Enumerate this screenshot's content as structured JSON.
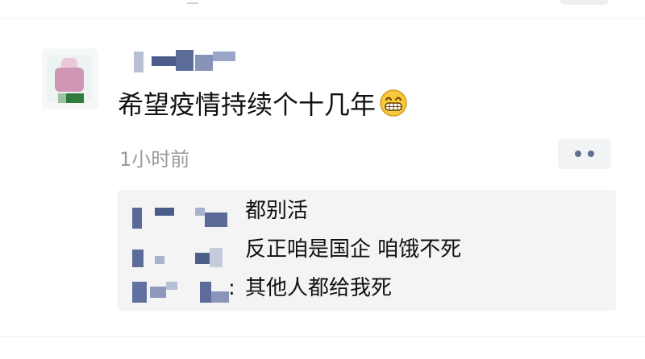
{
  "post": {
    "text": "希望疫情持续个十几年",
    "emoji": "grinning-face",
    "timestamp": "1小时前"
  },
  "comments": [
    {
      "text": "都别活"
    },
    {
      "text": "反正咱是国企 咱饿不死"
    },
    {
      "text": "其他人都给我死",
      "colon": ":"
    }
  ],
  "colors": {
    "text": "#111111",
    "timestamp": "#9a9a9a",
    "panel": "#f4f4f4",
    "more_dots": "#5e6f8f"
  }
}
